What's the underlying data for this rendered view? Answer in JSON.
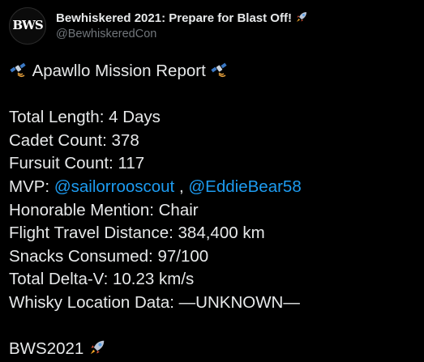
{
  "tweet": {
    "author": {
      "avatar_text": "BWS",
      "display_name": "Bewhiskered 2021: Prepare for Blast Off!",
      "display_name_icon": "rocket-icon",
      "handle": "@BewhiskeredCon"
    },
    "report": {
      "title": "Apawllo Mission Report",
      "title_icon": "satellite-icon",
      "stats": [
        {
          "label": "Total Length:",
          "value": "4 Days"
        },
        {
          "label": "Cadet Count:",
          "value": "378"
        },
        {
          "label": "Fursuit Count:",
          "value": "117"
        }
      ],
      "mvp": {
        "label": "MVP:",
        "mentions": [
          "@sailorrooscout",
          "@EddieBear58"
        ],
        "separator": ","
      },
      "stats_after": [
        {
          "label": "Honorable Mention:",
          "value": "Chair"
        },
        {
          "label": "Flight Travel Distance:",
          "value": "384,400 km"
        },
        {
          "label": "Snacks Consumed:",
          "value": "97/100"
        },
        {
          "label": "Total Delta-V:",
          "value": "10.23 km/s"
        },
        {
          "label": "Whisky Location Data:",
          "value": "—UNKNOWN—"
        }
      ],
      "closing_tag": "BWS2021",
      "closing_icon": "rocket-icon"
    },
    "colors": {
      "background": "#000000",
      "text": "#e7e9ea",
      "muted": "#71767b",
      "link": "#1d9bf0"
    }
  }
}
